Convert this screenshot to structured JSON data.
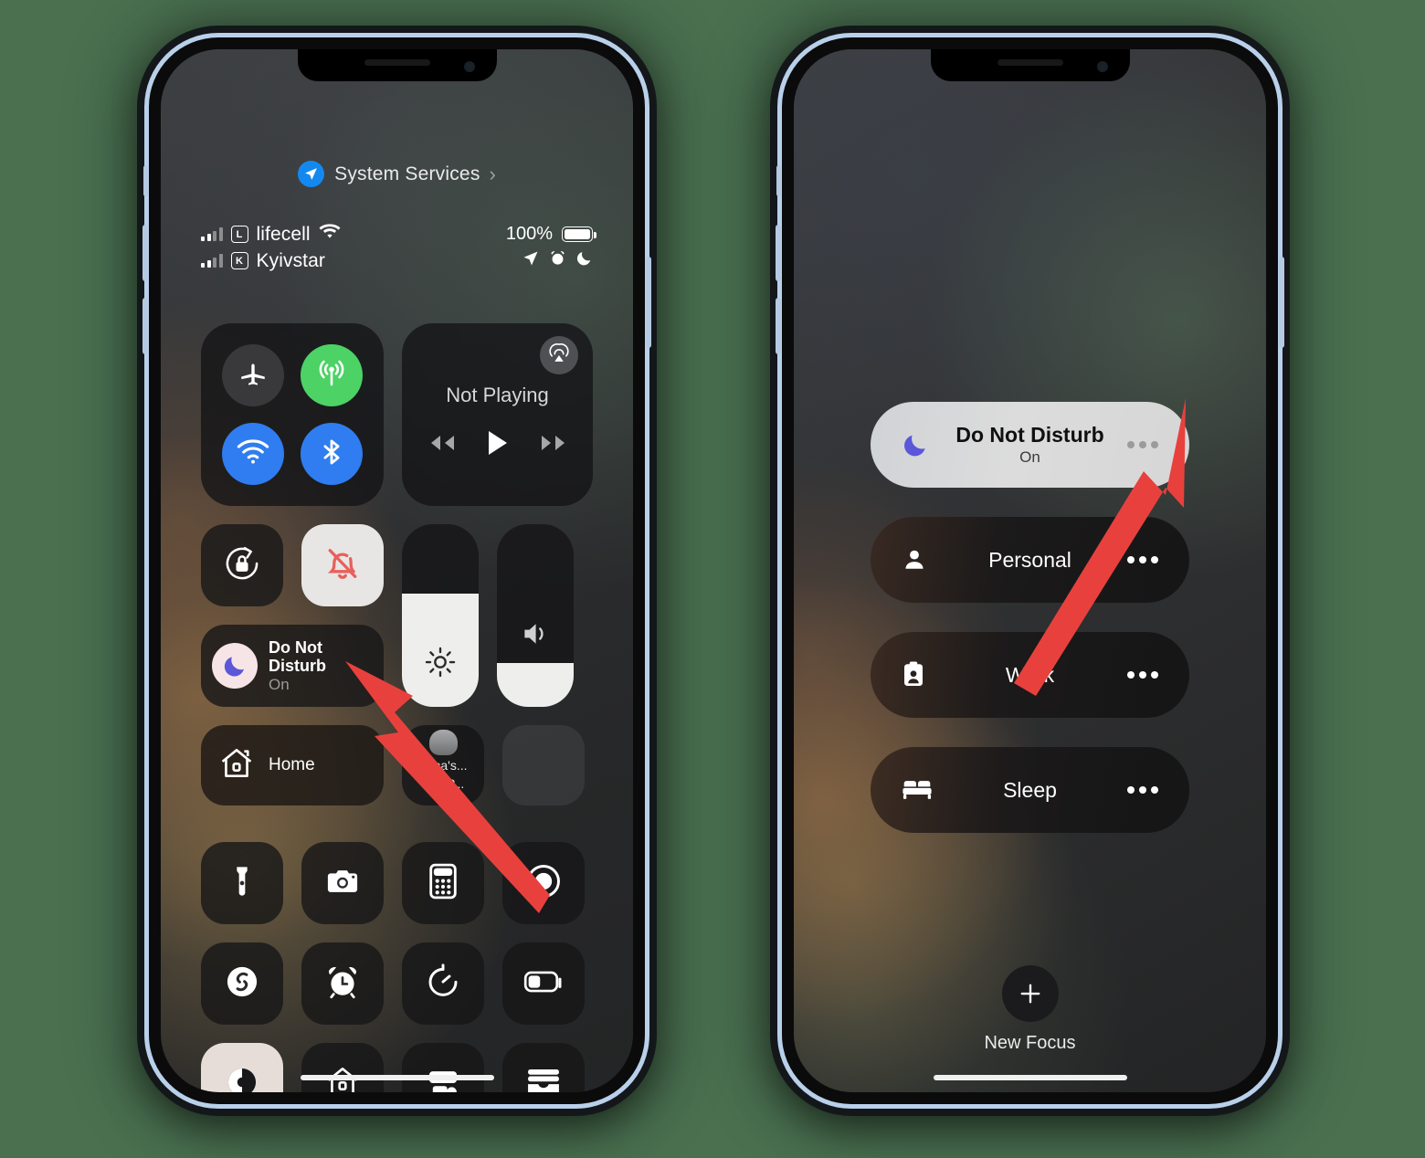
{
  "theme": {
    "background": "#4a7050",
    "frame_edge": "#b9d0ea",
    "arrow_color": "#e8413d",
    "accent_blue": "#2f7df0",
    "accent_green": "#4cd265",
    "dnd_purple": "#5b57d8"
  },
  "left_phone": {
    "system_services": {
      "label": "System Services",
      "chevron": "›",
      "icon": "location-arrow-icon"
    },
    "status_bar": {
      "sim1": {
        "badge": "L",
        "carrier": "lifecell",
        "wifi_icon": "wifi-icon"
      },
      "sim2": {
        "badge": "K",
        "carrier": "Kyivstar"
      },
      "battery_percent": "100%",
      "battery_icon": "battery-full-icon",
      "indicators": [
        "location-arrow-icon",
        "alarm-clock-icon",
        "crescent-moon-icon"
      ]
    },
    "connectivity": {
      "airplane": {
        "name": "Airplane Mode",
        "icon": "airplane-icon",
        "state": "off"
      },
      "cellular": {
        "name": "Cellular Data",
        "icon": "cellular-icon",
        "state": "on"
      },
      "wifi": {
        "name": "Wi-Fi",
        "icon": "wifi-icon",
        "state": "on"
      },
      "bluetooth": {
        "name": "Bluetooth",
        "icon": "bluetooth-icon",
        "state": "on"
      }
    },
    "media": {
      "title": "Not Playing",
      "airplay_icon": "airplay-icon",
      "prev_icon": "rewind-icon",
      "play_icon": "play-icon",
      "next_icon": "fast-forward-icon"
    },
    "toggles": {
      "rotation_lock": {
        "name": "Rotation Lock",
        "icon": "rotation-lock-icon",
        "state": "off"
      },
      "silent_mode": {
        "name": "Silent Mode",
        "icon": "bell-slash-icon",
        "state": "on"
      }
    },
    "do_not_disturb": {
      "title": "Do Not\nDisturb",
      "title_line1": "Do Not",
      "title_line2": "Disturb",
      "state": "On",
      "icon": "crescent-moon-icon"
    },
    "brightness": {
      "name": "Brightness",
      "icon": "sun-icon",
      "level_percent": 62
    },
    "volume": {
      "name": "Volume",
      "icon": "speaker-icon",
      "level_percent": 24
    },
    "home": {
      "label": "Home",
      "icon": "house-icon"
    },
    "homepod": {
      "label_line1": "Yana's...",
      "label_line2": "omeP...",
      "icon": "homepod-icon"
    },
    "shortcuts": [
      {
        "name": "Flashlight",
        "icon": "flashlight-icon"
      },
      {
        "name": "Camera",
        "icon": "camera-icon"
      },
      {
        "name": "Calculator",
        "icon": "calculator-icon"
      },
      {
        "name": "Screen Record",
        "icon": "record-icon"
      },
      {
        "name": "Shazam",
        "icon": "shazam-icon"
      },
      {
        "name": "Alarm",
        "icon": "alarm-clock-icon"
      },
      {
        "name": "Timer",
        "icon": "timer-icon"
      },
      {
        "name": "Low Power Mode",
        "icon": "battery-low-icon"
      },
      {
        "name": "Dark Mode",
        "icon": "dark-mode-icon"
      },
      {
        "name": "Home",
        "icon": "house-icon"
      },
      {
        "name": "Code Scanner",
        "icon": "scan-code-icon"
      },
      {
        "name": "Wallet",
        "icon": "wallet-icon"
      }
    ]
  },
  "right_phone": {
    "focus_modes": [
      {
        "label": "Do Not Disturb",
        "sublabel": "On",
        "icon": "crescent-moon-icon",
        "active": true,
        "more_icon": "ellipsis-icon"
      },
      {
        "label": "Personal",
        "sublabel": "",
        "icon": "person-icon",
        "active": false,
        "more_icon": "ellipsis-icon"
      },
      {
        "label": "Work",
        "sublabel": "",
        "icon": "id-badge-icon",
        "active": false,
        "more_icon": "ellipsis-icon"
      },
      {
        "label": "Sleep",
        "sublabel": "",
        "icon": "bed-icon",
        "active": false,
        "more_icon": "ellipsis-icon"
      }
    ],
    "new_focus": {
      "label": "New Focus",
      "icon": "plus-icon"
    }
  },
  "annotations": [
    {
      "name": "arrow-to-dnd-tile",
      "points_to": "Do Not Disturb tile in Control Center"
    },
    {
      "name": "arrow-to-dnd-ellipsis",
      "points_to": "ellipsis on Do Not Disturb focus row"
    }
  ]
}
